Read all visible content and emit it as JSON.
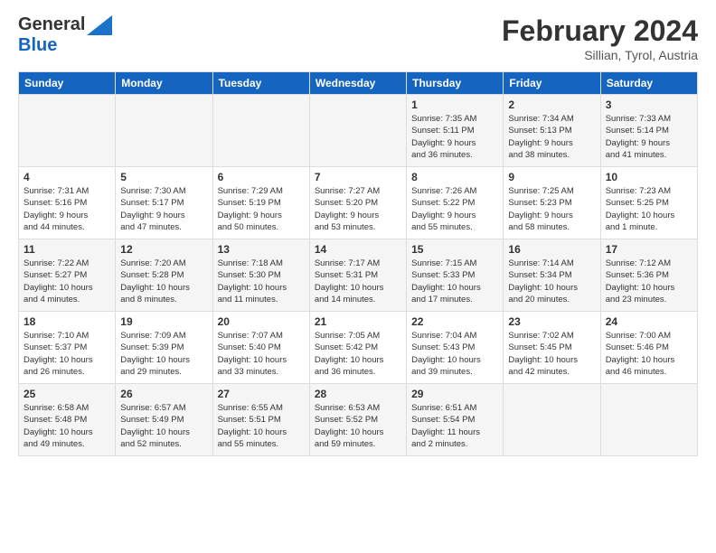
{
  "header": {
    "logo_line1": "General",
    "logo_line2": "Blue",
    "month_title": "February 2024",
    "location": "Sillian, Tyrol, Austria"
  },
  "days_of_week": [
    "Sunday",
    "Monday",
    "Tuesday",
    "Wednesday",
    "Thursday",
    "Friday",
    "Saturday"
  ],
  "weeks": [
    [
      {
        "day": "",
        "info": ""
      },
      {
        "day": "",
        "info": ""
      },
      {
        "day": "",
        "info": ""
      },
      {
        "day": "",
        "info": ""
      },
      {
        "day": "1",
        "info": "Sunrise: 7:35 AM\nSunset: 5:11 PM\nDaylight: 9 hours\nand 36 minutes."
      },
      {
        "day": "2",
        "info": "Sunrise: 7:34 AM\nSunset: 5:13 PM\nDaylight: 9 hours\nand 38 minutes."
      },
      {
        "day": "3",
        "info": "Sunrise: 7:33 AM\nSunset: 5:14 PM\nDaylight: 9 hours\nand 41 minutes."
      }
    ],
    [
      {
        "day": "4",
        "info": "Sunrise: 7:31 AM\nSunset: 5:16 PM\nDaylight: 9 hours\nand 44 minutes."
      },
      {
        "day": "5",
        "info": "Sunrise: 7:30 AM\nSunset: 5:17 PM\nDaylight: 9 hours\nand 47 minutes."
      },
      {
        "day": "6",
        "info": "Sunrise: 7:29 AM\nSunset: 5:19 PM\nDaylight: 9 hours\nand 50 minutes."
      },
      {
        "day": "7",
        "info": "Sunrise: 7:27 AM\nSunset: 5:20 PM\nDaylight: 9 hours\nand 53 minutes."
      },
      {
        "day": "8",
        "info": "Sunrise: 7:26 AM\nSunset: 5:22 PM\nDaylight: 9 hours\nand 55 minutes."
      },
      {
        "day": "9",
        "info": "Sunrise: 7:25 AM\nSunset: 5:23 PM\nDaylight: 9 hours\nand 58 minutes."
      },
      {
        "day": "10",
        "info": "Sunrise: 7:23 AM\nSunset: 5:25 PM\nDaylight: 10 hours\nand 1 minute."
      }
    ],
    [
      {
        "day": "11",
        "info": "Sunrise: 7:22 AM\nSunset: 5:27 PM\nDaylight: 10 hours\nand 4 minutes."
      },
      {
        "day": "12",
        "info": "Sunrise: 7:20 AM\nSunset: 5:28 PM\nDaylight: 10 hours\nand 8 minutes."
      },
      {
        "day": "13",
        "info": "Sunrise: 7:18 AM\nSunset: 5:30 PM\nDaylight: 10 hours\nand 11 minutes."
      },
      {
        "day": "14",
        "info": "Sunrise: 7:17 AM\nSunset: 5:31 PM\nDaylight: 10 hours\nand 14 minutes."
      },
      {
        "day": "15",
        "info": "Sunrise: 7:15 AM\nSunset: 5:33 PM\nDaylight: 10 hours\nand 17 minutes."
      },
      {
        "day": "16",
        "info": "Sunrise: 7:14 AM\nSunset: 5:34 PM\nDaylight: 10 hours\nand 20 minutes."
      },
      {
        "day": "17",
        "info": "Sunrise: 7:12 AM\nSunset: 5:36 PM\nDaylight: 10 hours\nand 23 minutes."
      }
    ],
    [
      {
        "day": "18",
        "info": "Sunrise: 7:10 AM\nSunset: 5:37 PM\nDaylight: 10 hours\nand 26 minutes."
      },
      {
        "day": "19",
        "info": "Sunrise: 7:09 AM\nSunset: 5:39 PM\nDaylight: 10 hours\nand 29 minutes."
      },
      {
        "day": "20",
        "info": "Sunrise: 7:07 AM\nSunset: 5:40 PM\nDaylight: 10 hours\nand 33 minutes."
      },
      {
        "day": "21",
        "info": "Sunrise: 7:05 AM\nSunset: 5:42 PM\nDaylight: 10 hours\nand 36 minutes."
      },
      {
        "day": "22",
        "info": "Sunrise: 7:04 AM\nSunset: 5:43 PM\nDaylight: 10 hours\nand 39 minutes."
      },
      {
        "day": "23",
        "info": "Sunrise: 7:02 AM\nSunset: 5:45 PM\nDaylight: 10 hours\nand 42 minutes."
      },
      {
        "day": "24",
        "info": "Sunrise: 7:00 AM\nSunset: 5:46 PM\nDaylight: 10 hours\nand 46 minutes."
      }
    ],
    [
      {
        "day": "25",
        "info": "Sunrise: 6:58 AM\nSunset: 5:48 PM\nDaylight: 10 hours\nand 49 minutes."
      },
      {
        "day": "26",
        "info": "Sunrise: 6:57 AM\nSunset: 5:49 PM\nDaylight: 10 hours\nand 52 minutes."
      },
      {
        "day": "27",
        "info": "Sunrise: 6:55 AM\nSunset: 5:51 PM\nDaylight: 10 hours\nand 55 minutes."
      },
      {
        "day": "28",
        "info": "Sunrise: 6:53 AM\nSunset: 5:52 PM\nDaylight: 10 hours\nand 59 minutes."
      },
      {
        "day": "29",
        "info": "Sunrise: 6:51 AM\nSunset: 5:54 PM\nDaylight: 11 hours\nand 2 minutes."
      },
      {
        "day": "",
        "info": ""
      },
      {
        "day": "",
        "info": ""
      }
    ]
  ]
}
